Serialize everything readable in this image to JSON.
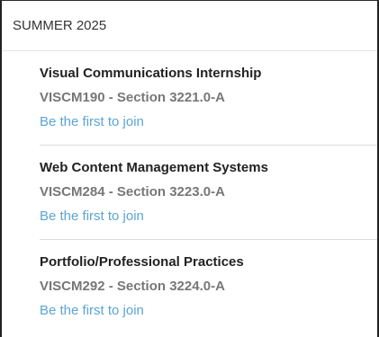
{
  "term": {
    "label": "SUMMER 2025"
  },
  "courses": [
    {
      "title": "Visual Communications Internship",
      "section": "VISCM190 - Section 3221.0-A",
      "join_label": "Be the first to join"
    },
    {
      "title": "Web Content Management Systems",
      "section": "VISCM284 - Section 3223.0-A",
      "join_label": "Be the first to join"
    },
    {
      "title": "Portfolio/Professional Practices",
      "section": "VISCM292 - Section 3224.0-A",
      "join_label": "Be the first to join"
    }
  ],
  "colors": {
    "link": "#5aa5d6",
    "title": "#222222",
    "section": "#777777"
  }
}
